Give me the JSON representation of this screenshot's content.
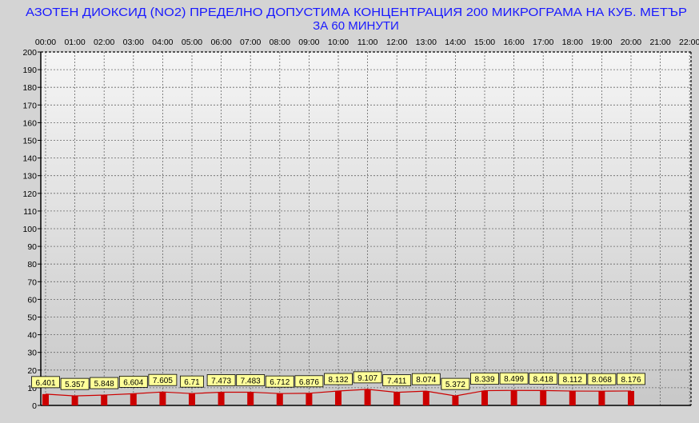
{
  "chart_data": {
    "type": "bar",
    "title_line1": "АЗОТЕН ДИОКСИД   (NO2)     ПРЕДЕЛНО ДОПУСТИМА КОНЦЕНТРАЦИЯ 200 МИКРОГРАМА  НА КУБ. МЕТЪР",
    "title_line2": "ЗА 60 МИНУТИ",
    "xlabel": "",
    "ylabel": "",
    "x_ticks": [
      "00:00",
      "01:00",
      "02:00",
      "03:00",
      "04:00",
      "05:00",
      "06:00",
      "07:00",
      "08:00",
      "09:00",
      "10:00",
      "11:00",
      "12:00",
      "13:00",
      "14:00",
      "15:00",
      "16:00",
      "17:00",
      "18:00",
      "19:00",
      "20:00",
      "21:00",
      "22:00"
    ],
    "y_ticks": [
      0,
      10,
      20,
      30,
      40,
      50,
      60,
      70,
      80,
      90,
      100,
      110,
      120,
      130,
      140,
      150,
      160,
      170,
      180,
      190,
      200
    ],
    "ylim": [
      0,
      200
    ],
    "categories": [
      "00:00",
      "01:00",
      "02:00",
      "03:00",
      "04:00",
      "05:00",
      "06:00",
      "07:00",
      "08:00",
      "09:00",
      "10:00",
      "11:00",
      "12:00",
      "13:00",
      "14:00",
      "15:00",
      "16:00",
      "17:00",
      "18:00",
      "19:00",
      "20:00"
    ],
    "values": [
      6.401,
      5.357,
      5.848,
      6.604,
      7.605,
      6.71,
      7.473,
      7.483,
      6.712,
      6.876,
      8.132,
      9.107,
      7.411,
      8.074,
      5.372,
      8.339,
      8.499,
      8.418,
      8.112,
      8.068,
      8.176
    ],
    "value_labels": [
      "6.401",
      "5.357",
      "5.848",
      "6.604",
      "7.605",
      "6.71",
      "7.473",
      "7.483",
      "6.712",
      "6.876",
      "8.132",
      "9.107",
      "7.411",
      "8.074",
      "5.372",
      "8.339",
      "8.499",
      "8.418",
      "8.112",
      "8.068",
      "8.176"
    ],
    "grid": true,
    "legend": "none",
    "colors": {
      "bar": "#cc0000",
      "line": "#cc0000",
      "label_bg": "#ffff99",
      "title": "#1a1aff",
      "plot_top": "#f5f5f5",
      "plot_bottom": "#c8c8c8",
      "background": "#d4d4d4"
    }
  }
}
